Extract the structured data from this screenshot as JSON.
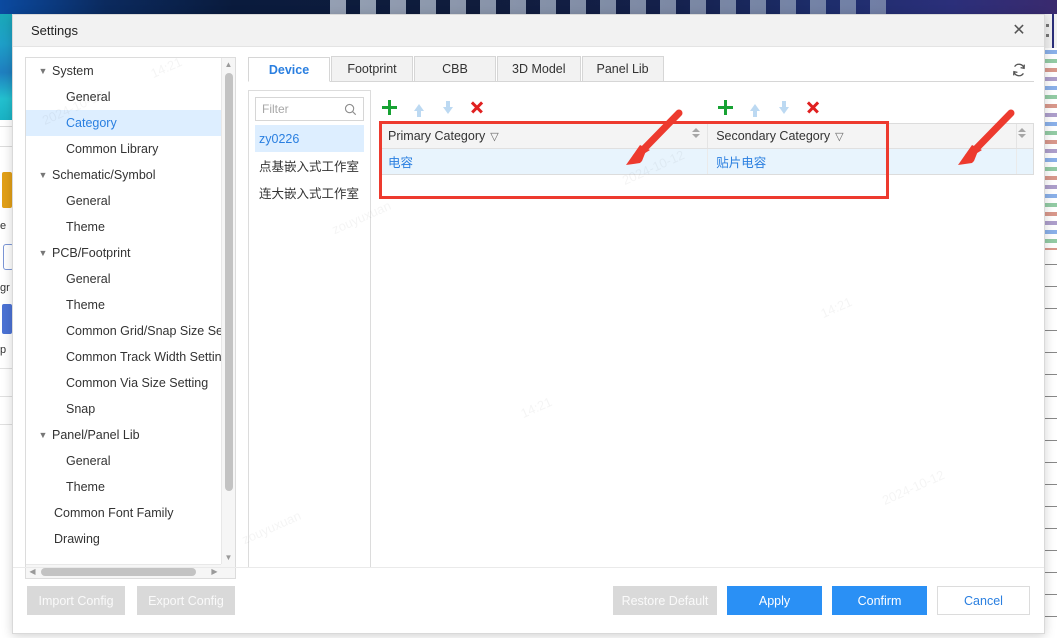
{
  "window": {
    "title": "Settings",
    "close_icon": "close-icon"
  },
  "sidebar": {
    "items": [
      {
        "label": "System",
        "level": 0,
        "expandable": true,
        "selected": false
      },
      {
        "label": "General",
        "level": 1,
        "expandable": false,
        "selected": false
      },
      {
        "label": "Category",
        "level": 1,
        "expandable": false,
        "selected": true
      },
      {
        "label": "Common Library",
        "level": 1,
        "expandable": false,
        "selected": false
      },
      {
        "label": "Schematic/Symbol",
        "level": 0,
        "expandable": true,
        "selected": false
      },
      {
        "label": "General",
        "level": 1,
        "expandable": false,
        "selected": false
      },
      {
        "label": "Theme",
        "level": 1,
        "expandable": false,
        "selected": false
      },
      {
        "label": "PCB/Footprint",
        "level": 0,
        "expandable": true,
        "selected": false
      },
      {
        "label": "General",
        "level": 1,
        "expandable": false,
        "selected": false
      },
      {
        "label": "Theme",
        "level": 1,
        "expandable": false,
        "selected": false
      },
      {
        "label": "Common Grid/Snap Size Se",
        "level": 1,
        "expandable": false,
        "selected": false
      },
      {
        "label": "Common Track Width Settin",
        "level": 1,
        "expandable": false,
        "selected": false
      },
      {
        "label": "Common Via Size Setting",
        "level": 1,
        "expandable": false,
        "selected": false
      },
      {
        "label": "Snap",
        "level": 1,
        "expandable": false,
        "selected": false
      },
      {
        "label": "Panel/Panel Lib",
        "level": 0,
        "expandable": true,
        "selected": false
      },
      {
        "label": "General",
        "level": 1,
        "expandable": false,
        "selected": false
      },
      {
        "label": "Theme",
        "level": 1,
        "expandable": false,
        "selected": false
      },
      {
        "label": "Common Font Family",
        "level": 2,
        "expandable": false,
        "selected": false
      },
      {
        "label": "Drawing",
        "level": 2,
        "expandable": false,
        "selected": false
      }
    ],
    "caret_icon": "caret-down-icon"
  },
  "tabs": [
    {
      "label": "Device",
      "active": true
    },
    {
      "label": "Footprint",
      "active": false
    },
    {
      "label": "CBB",
      "active": false
    },
    {
      "label": "3D Model",
      "active": false
    },
    {
      "label": "Panel Lib",
      "active": false
    }
  ],
  "refresh": {
    "icon": "refresh-icon"
  },
  "filter": {
    "placeholder": "Filter",
    "value": "",
    "icon": "search-icon"
  },
  "library_list": [
    {
      "label": "zy0226",
      "selected": true
    },
    {
      "label": "点基嵌入式工作室",
      "selected": false
    },
    {
      "label": "连大嵌入式工作室",
      "selected": false
    }
  ],
  "toolbar_primary": {
    "add": "add-icon",
    "move_up": "arrow-up-icon",
    "move_down": "arrow-down-icon",
    "delete": "delete-icon"
  },
  "toolbar_secondary": {
    "add": "add-icon",
    "move_up": "arrow-up-icon",
    "move_down": "arrow-down-icon",
    "delete": "delete-icon"
  },
  "table": {
    "columns": [
      {
        "header": "Primary Category",
        "filter_icon": "filter-icon",
        "sortable": true
      },
      {
        "header": "Secondary Category",
        "filter_icon": "filter-icon",
        "sortable": false
      },
      {
        "header": "",
        "filter_icon": "",
        "sortable": true
      }
    ],
    "rows": [
      {
        "cells": [
          "电容",
          "贴片电容",
          ""
        ],
        "selected": true
      }
    ]
  },
  "footer": {
    "import_label": "Import Config",
    "export_label": "Export Config",
    "restore_label": "Restore Default",
    "apply_label": "Apply",
    "confirm_label": "Confirm",
    "cancel_label": "Cancel"
  },
  "colors": {
    "accent_blue": "#2a7fe0",
    "button_blue": "#2a90f5",
    "annotation_red": "#ed3a2e",
    "add_green": "#17a233",
    "delete_red": "#e02020",
    "selection_bg": "#ddeeff",
    "row_selection_bg": "#e8f4fd"
  },
  "annotations": {
    "highlight_box": "red-rectangle-highlight",
    "arrow_primary": "red-arrow-pointing-to-primary-add",
    "arrow_secondary": "red-arrow-pointing-to-secondary-add"
  },
  "watermarks": [
    "2024-10-12",
    "14:21",
    "zouyuxuan"
  ]
}
